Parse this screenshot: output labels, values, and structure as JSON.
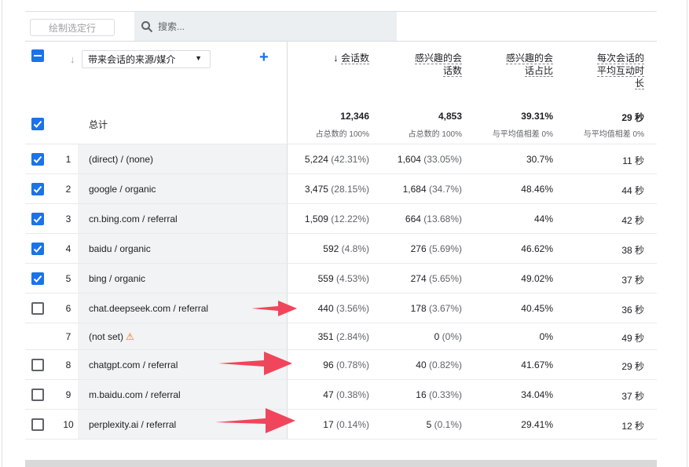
{
  "toolbar": {
    "draw_rows_label": "绘制选定行",
    "search_placeholder": "搜索..."
  },
  "dimension_header": {
    "label": "带来会话的来源/媒介"
  },
  "metric_headers": [
    {
      "line1": "会话数",
      "line2": "",
      "line3": ""
    },
    {
      "line1": "感兴趣的会",
      "line2": "话数",
      "line3": ""
    },
    {
      "line1": "感兴趣的会",
      "line2": "话占比",
      "line3": ""
    },
    {
      "line1": "每次会话的",
      "line2": "平均互动时",
      "line3": "长"
    }
  ],
  "totals": {
    "label": "总计",
    "values": [
      "12,346",
      "4,853",
      "39.31%",
      "29 秒"
    ],
    "subs": [
      "占总数的 100%",
      "占总数的 100%",
      "与平均值相差 0%",
      "与平均值相差 0%"
    ]
  },
  "rows": [
    {
      "idx": "1",
      "dim": "(direct) / (none)",
      "sessions": "5,224",
      "sessions_pct": "(42.31%)",
      "engaged": "1,604",
      "engaged_pct": "(33.05%)",
      "rate": "30.7%",
      "time": "11 秒",
      "checked": true
    },
    {
      "idx": "2",
      "dim": "google / organic",
      "sessions": "3,475",
      "sessions_pct": "(28.15%)",
      "engaged": "1,684",
      "engaged_pct": "(34.7%)",
      "rate": "48.46%",
      "time": "44 秒",
      "checked": true
    },
    {
      "idx": "3",
      "dim": "cn.bing.com / referral",
      "sessions": "1,509",
      "sessions_pct": "(12.22%)",
      "engaged": "664",
      "engaged_pct": "(13.68%)",
      "rate": "44%",
      "time": "42 秒",
      "checked": true
    },
    {
      "idx": "4",
      "dim": "baidu / organic",
      "sessions": "592",
      "sessions_pct": "(4.8%)",
      "engaged": "276",
      "engaged_pct": "(5.69%)",
      "rate": "46.62%",
      "time": "38 秒",
      "checked": true
    },
    {
      "idx": "5",
      "dim": "bing / organic",
      "sessions": "559",
      "sessions_pct": "(4.53%)",
      "engaged": "274",
      "engaged_pct": "(5.65%)",
      "rate": "49.02%",
      "time": "37 秒",
      "checked": true
    },
    {
      "idx": "6",
      "dim": "chat.deepseek.com / referral",
      "sessions": "440",
      "sessions_pct": "(3.56%)",
      "engaged": "178",
      "engaged_pct": "(3.67%)",
      "rate": "40.45%",
      "time": "36 秒",
      "checked": false
    },
    {
      "idx": "7",
      "dim": "(not set)",
      "sessions": "351",
      "sessions_pct": "(2.84%)",
      "engaged": "0",
      "engaged_pct": "(0%)",
      "rate": "0%",
      "time": "49 秒",
      "checked": null,
      "warning": "⚠"
    },
    {
      "idx": "8",
      "dim": "chatgpt.com / referral",
      "sessions": "96",
      "sessions_pct": "(0.78%)",
      "engaged": "40",
      "engaged_pct": "(0.82%)",
      "rate": "41.67%",
      "time": "29 秒",
      "checked": false
    },
    {
      "idx": "9",
      "dim": "m.baidu.com / referral",
      "sessions": "47",
      "sessions_pct": "(0.38%)",
      "engaged": "16",
      "engaged_pct": "(0.33%)",
      "rate": "34.04%",
      "time": "37 秒",
      "checked": false
    },
    {
      "idx": "10",
      "dim": "perplexity.ai / referral",
      "sessions": "17",
      "sessions_pct": "(0.14%)",
      "engaged": "5",
      "engaged_pct": "(0.1%)",
      "rate": "29.41%",
      "time": "12 秒",
      "checked": false
    }
  ],
  "colors": {
    "accent": "#1a73e8",
    "annotation_arrow": "#f0455b"
  }
}
